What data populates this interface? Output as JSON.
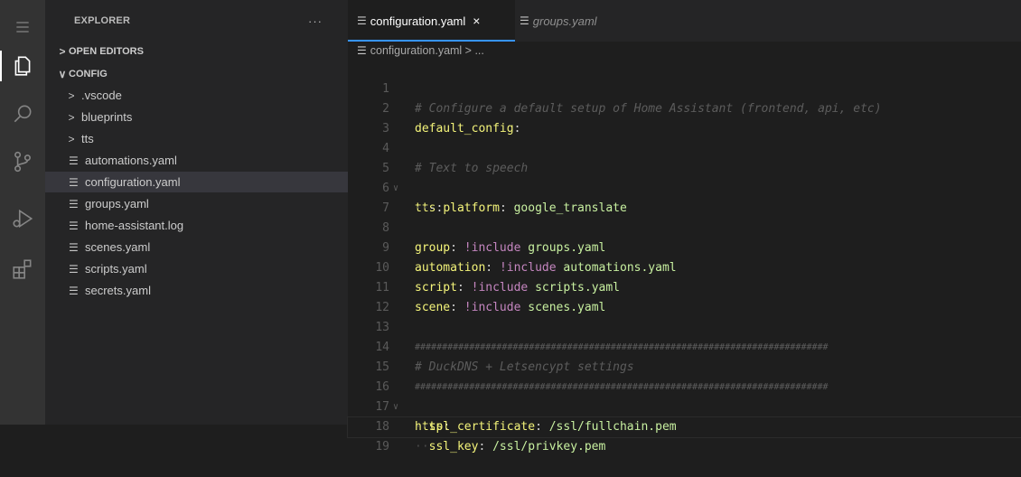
{
  "sidebar": {
    "title": "EXPLORER",
    "more": "···",
    "open_editors": "OPEN EDITORS",
    "config": "CONFIG",
    "folders": [
      ".vscode",
      "blueprints",
      "tts"
    ],
    "files": [
      "automations.yaml",
      "configuration.yaml",
      "groups.yaml",
      "home-assistant.log",
      "scenes.yaml",
      "scripts.yaml",
      "secrets.yaml"
    ]
  },
  "tabs": [
    {
      "label": "configuration.yaml",
      "close": "×"
    },
    {
      "label": "groups.yaml"
    }
  ],
  "breadcrumb": "configuration.yaml > ...",
  "code": {
    "numbers": [
      "1",
      "2",
      "3",
      "4",
      "5",
      "6",
      "7",
      "8",
      "9",
      "10",
      "11",
      "12",
      "13",
      "14",
      "15",
      "16",
      "17",
      "18",
      "19"
    ],
    "l1": "# Configure a default setup of Home Assistant (frontend, api, etc)",
    "l2_key": "default_config",
    "l4": "# Text to speech",
    "l5_key": "tts",
    "l6_ws": "··",
    "l6_dash": "- ",
    "l6_key": "platform",
    "l6_val": "google_translate",
    "l8_key": "group",
    "l8_tag": "!include",
    "l8_val": "groups.yaml",
    "l9_key": "automation",
    "l9_tag": "!include",
    "l9_val": "automations.yaml",
    "l10_key": "script",
    "l10_tag": "!include",
    "l10_val": "scripts.yaml",
    "l11_key": "scene",
    "l11_tag": "!include",
    "l11_val": "scenes.yaml",
    "l13": "############################################################################",
    "l14": "# DuckDNS + Letsencypt settings",
    "l15": "############################################################################",
    "l16_key": "http",
    "l17_ws": "··",
    "l17_key": "ssl_certificate",
    "l17_val": "/ssl/fullchain.pem",
    "l18_ws": "··",
    "l18_key": "ssl_key",
    "l18_val": "/ssl/privkey.pem",
    "colon": ":"
  }
}
